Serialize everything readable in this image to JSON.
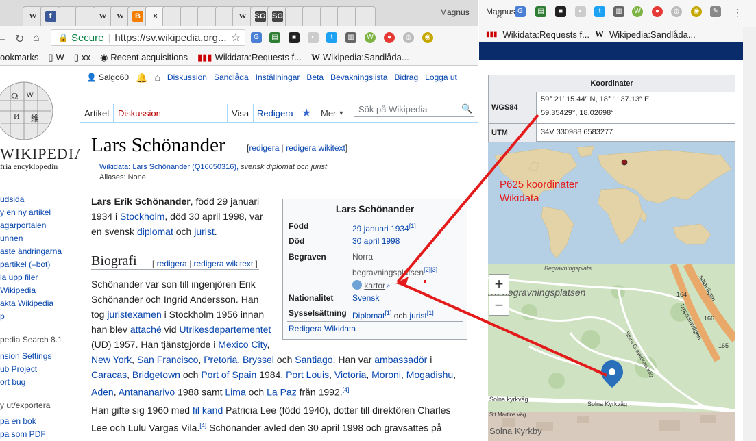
{
  "browser": {
    "tabs_left": [
      "W",
      "f",
      "",
      "",
      "W",
      "W",
      "B",
      "×",
      "",
      "",
      "",
      "",
      "W",
      "SG",
      "SG",
      "",
      "",
      "",
      "",
      ""
    ],
    "profile_name": "Magnus",
    "address": {
      "secure": "Secure",
      "url": "https://sv.wikipedia.org..."
    },
    "bookmarks": [
      "ookmarks",
      "W",
      "xx",
      "Recent acquisitions",
      "Wikidata:Requests f...",
      "Wikipedia:Sandlåda..."
    ],
    "right_bookmarks": [
      "Wikidata:Requests f...",
      "Wikipedia:Sandlåda..."
    ]
  },
  "personal": {
    "user": "Salgo60",
    "links": [
      "Diskussion",
      "Sandlåda",
      "Inställningar",
      "Beta",
      "Bevakningslista",
      "Bidrag",
      "Logga ut"
    ]
  },
  "logo": {
    "name": "WIKIPEDIA",
    "sub": "fria encyklopedin"
  },
  "sidebar": {
    "items": [
      "udsida",
      "y en ny artikel",
      "agarportalen",
      "unnen",
      "aste ändringarna",
      "partikel (–bot)",
      "la upp filer",
      "Wikipedia",
      "akta Wikipedia",
      "p"
    ],
    "head1": "pedia Search 8.1",
    "items2": [
      "nsion Settings",
      "ub Project",
      "ort bug"
    ],
    "head2": "y ut/exportera",
    "items3": [
      "pa en bok",
      "pa som PDF"
    ]
  },
  "wtabs": {
    "article": "Artikel",
    "talk": "Diskussion",
    "read": "Visa",
    "edit": "Redigera",
    "more": "Mer",
    "search_placeholder": "Sök på Wikipedia"
  },
  "article": {
    "title": "Lars Schönander",
    "edit_links": {
      "open": "[",
      "edit": "redigera",
      "sep": "|",
      "wikitext": "redigera wikitext",
      "close": "]"
    },
    "wikidata_line": {
      "prefix": "Wikidata:",
      "label": "Lars Schönander",
      "qid": "(Q16650316),",
      "desc": "svensk diplomat och jurist"
    },
    "aliases": "Aliases: None",
    "intro": [
      {
        "t": "Lars Erik Schönander",
        "b": true
      },
      {
        "t": ", född 29 januari"
      }
    ],
    "intro2": [
      {
        "t": "1934 i "
      },
      {
        "t": "Stockholm",
        "l": true
      },
      {
        "t": ", död 30 april 1998, var"
      }
    ],
    "intro3": [
      {
        "t": "en svensk "
      },
      {
        "t": "diplomat",
        "l": true
      },
      {
        "t": " och "
      },
      {
        "t": "jurist",
        "l": true
      },
      {
        "t": "."
      }
    ],
    "h2": "Biografi",
    "bio": [
      [
        {
          "t": "Schönander var son till ingenjören Erik"
        }
      ],
      [
        {
          "t": "Schönander och Ingrid Andersson. Han"
        }
      ],
      [
        {
          "t": "tog "
        },
        {
          "t": "juristexamen",
          "l": true
        },
        {
          "t": " i Stockholm 1956 innan"
        }
      ],
      [
        {
          "t": "han blev "
        },
        {
          "t": "attaché",
          "l": true
        },
        {
          "t": " vid "
        },
        {
          "t": "Utrikesdepartementet",
          "l": true
        }
      ],
      [
        {
          "t": "(UD) 1957. Han tjänstgjorde i "
        },
        {
          "t": "Mexico City",
          "l": true
        },
        {
          "t": ","
        }
      ],
      [
        {
          "t": "New York",
          "l": true
        },
        {
          "t": ", "
        },
        {
          "t": "San Francisco",
          "l": true
        },
        {
          "t": ", "
        },
        {
          "t": "Pretoria",
          "l": true
        },
        {
          "t": ", "
        },
        {
          "t": "Bryssel",
          "l": true
        },
        {
          "t": " och "
        },
        {
          "t": "Santiago",
          "l": true
        },
        {
          "t": ". Han var "
        },
        {
          "t": "ambassadör",
          "l": true
        },
        {
          "t": " i"
        }
      ],
      [
        {
          "t": "Caracas",
          "l": true
        },
        {
          "t": ", "
        },
        {
          "t": "Bridgetown",
          "l": true
        },
        {
          "t": " och "
        },
        {
          "t": "Port of Spain",
          "l": true
        },
        {
          "t": " 1984, "
        },
        {
          "t": "Port Louis",
          "l": true
        },
        {
          "t": ", "
        },
        {
          "t": "Victoria",
          "l": true
        },
        {
          "t": ", "
        },
        {
          "t": "Moroni",
          "l": true
        },
        {
          "t": ", "
        },
        {
          "t": "Mogadishu",
          "l": true
        },
        {
          "t": ","
        }
      ],
      [
        {
          "t": "Aden",
          "l": true
        },
        {
          "t": ", "
        },
        {
          "t": "Antananarivo",
          "l": true
        },
        {
          "t": " 1988 samt "
        },
        {
          "t": "Lima",
          "l": true
        },
        {
          "t": " och "
        },
        {
          "t": "La Paz",
          "l": true
        },
        {
          "t": " från 1992."
        },
        {
          "t": "[4]",
          "sup": true
        }
      ]
    ],
    "bio2": [
      [
        {
          "t": "Han gifte sig 1960 med "
        },
        {
          "t": "fil kand",
          "l": true
        },
        {
          "t": " Patricia Lee (född 1940), dotter till direktören Charles"
        }
      ],
      [
        {
          "t": "Lee och Lulu Vargas Vila."
        },
        {
          "t": "[4]",
          "sup": true
        },
        {
          "t": " Schönander avled den 30 april 1998 och gravsattes på"
        }
      ]
    ]
  },
  "infobox": {
    "title": "Lars Schönander",
    "rows": [
      {
        "label": "Född",
        "value": "29 januari 1934",
        "ref": "[1]"
      },
      {
        "label": "Död",
        "value": "30 april 1998"
      },
      {
        "label": "Begraven",
        "value1": "Norra",
        "value2": "begravningsplatsen",
        "ref": "[2][3]",
        "maplink": "kartor"
      },
      {
        "label": "Nationalitet",
        "value": "Svensk"
      },
      {
        "label": "Sysselsättning",
        "value": "Diplomat",
        "ref": "[1]",
        "and": "och",
        "value2": "jurist",
        "ref2": "[1]"
      }
    ],
    "footer": "Redigera Wikidata"
  },
  "coords": {
    "header": "Koordinater",
    "wgs_label": "WGS84",
    "wgs_dms": "59° 21′ 15.44″ N, 18° 1′ 37.13″ E",
    "wgs_dec": "59.35429°, 18.02698°",
    "utm_label": "UTM",
    "utm_value": "34V 330988 6583277"
  },
  "annotation": {
    "line1": "P625 koordinater",
    "line2": "Wikidata",
    "color": "#e31b1b"
  },
  "streetmap": {
    "zoom_in": "+",
    "zoom_out": "−",
    "labels": [
      "Begravningsplats",
      "rra begravningsplatsen",
      "Solna Kyrkväg",
      "Solna kyrkväg",
      "Solna Kyrkby",
      "Stora Gravkorets väg",
      "Uppsalavägen",
      "S:t Martins väg",
      "164",
      "166",
      "165",
      "salavägen"
    ]
  }
}
